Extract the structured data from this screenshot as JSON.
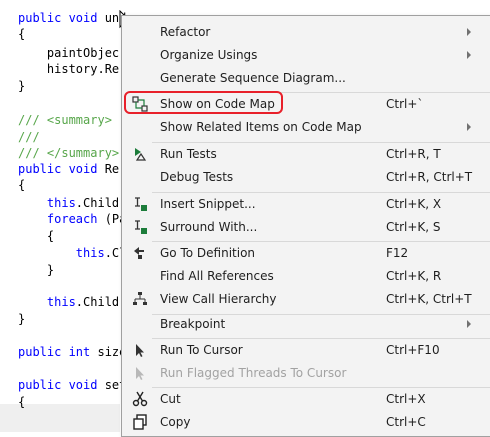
{
  "code": {
    "lines": [
      {
        "kw": "public void ",
        "text": "und"
      },
      {
        "kw": "",
        "text": "{"
      },
      {
        "kw": "",
        "text": "    paintObjec"
      },
      {
        "kw": "",
        "text": "    history.Re"
      },
      {
        "kw": "",
        "text": "}"
      },
      {
        "kw": "",
        "text": "/// <summary>",
        "comment": true
      },
      {
        "kw": "",
        "text": "///",
        "comment": true
      },
      {
        "kw": "",
        "text": "/// </summary>",
        "comment": true
      },
      {
        "kw": "public void ",
        "text": "Re"
      },
      {
        "kw": "",
        "text": "{"
      },
      {
        "kw": "    this",
        "text": ".Childr"
      },
      {
        "kw": "    foreach",
        "text": " (Pa"
      },
      {
        "kw": "",
        "text": "    {"
      },
      {
        "kw": "        this",
        "text": ".Cl"
      },
      {
        "kw": "",
        "text": "    }"
      },
      {
        "kw": "    this",
        "text": ".Childr"
      },
      {
        "kw": "",
        "text": "}"
      },
      {
        "kw": "public int ",
        "text": "size"
      },
      {
        "kw": "public void ",
        "text": "set"
      },
      {
        "kw": "",
        "text": "{"
      }
    ]
  },
  "menu": {
    "items": [
      {
        "label": "Refactor",
        "shortcut": "",
        "submenu": true,
        "icon": ""
      },
      {
        "label": "Organize Usings",
        "shortcut": "",
        "submenu": true,
        "icon": ""
      },
      {
        "label": "Generate Sequence Diagram...",
        "shortcut": "",
        "submenu": false,
        "icon": ""
      },
      {
        "label": "Show on Code Map",
        "shortcut": "Ctrl+`",
        "submenu": false,
        "icon": "code-map-icon"
      },
      {
        "label": "Show Related Items on Code Map",
        "shortcut": "",
        "submenu": true,
        "icon": ""
      },
      {
        "label": "Run Tests",
        "shortcut": "Ctrl+R, T",
        "submenu": false,
        "icon": "run-tests-icon"
      },
      {
        "label": "Debug Tests",
        "shortcut": "Ctrl+R, Ctrl+T",
        "submenu": false,
        "icon": ""
      },
      {
        "label": "Insert Snippet...",
        "shortcut": "Ctrl+K, X",
        "submenu": false,
        "icon": "snippet-icon"
      },
      {
        "label": "Surround With...",
        "shortcut": "Ctrl+K, S",
        "submenu": false,
        "icon": "surround-icon"
      },
      {
        "label": "Go To Definition",
        "shortcut": "F12",
        "submenu": false,
        "icon": "definition-icon"
      },
      {
        "label": "Find All References",
        "shortcut": "Ctrl+K, R",
        "submenu": false,
        "icon": ""
      },
      {
        "label": "View Call Hierarchy",
        "shortcut": "Ctrl+K, Ctrl+T",
        "submenu": false,
        "icon": "hierarchy-icon"
      },
      {
        "label": "Breakpoint",
        "shortcut": "",
        "submenu": true,
        "icon": ""
      },
      {
        "label": "Run To Cursor",
        "shortcut": "Ctrl+F10",
        "submenu": false,
        "icon": "run-cursor-icon"
      },
      {
        "label": "Run Flagged Threads To Cursor",
        "shortcut": "",
        "submenu": false,
        "icon": "run-flagged-icon",
        "disabled": true
      },
      {
        "label": "Cut",
        "shortcut": "Ctrl+X",
        "submenu": false,
        "icon": "scissors-icon"
      },
      {
        "label": "Copy",
        "shortcut": "Ctrl+C",
        "submenu": false,
        "icon": "copy-icon"
      }
    ]
  },
  "colors": {
    "highlight_ring": "#e8202a",
    "keyword": "#0000ff",
    "comment": "#57a64a"
  }
}
